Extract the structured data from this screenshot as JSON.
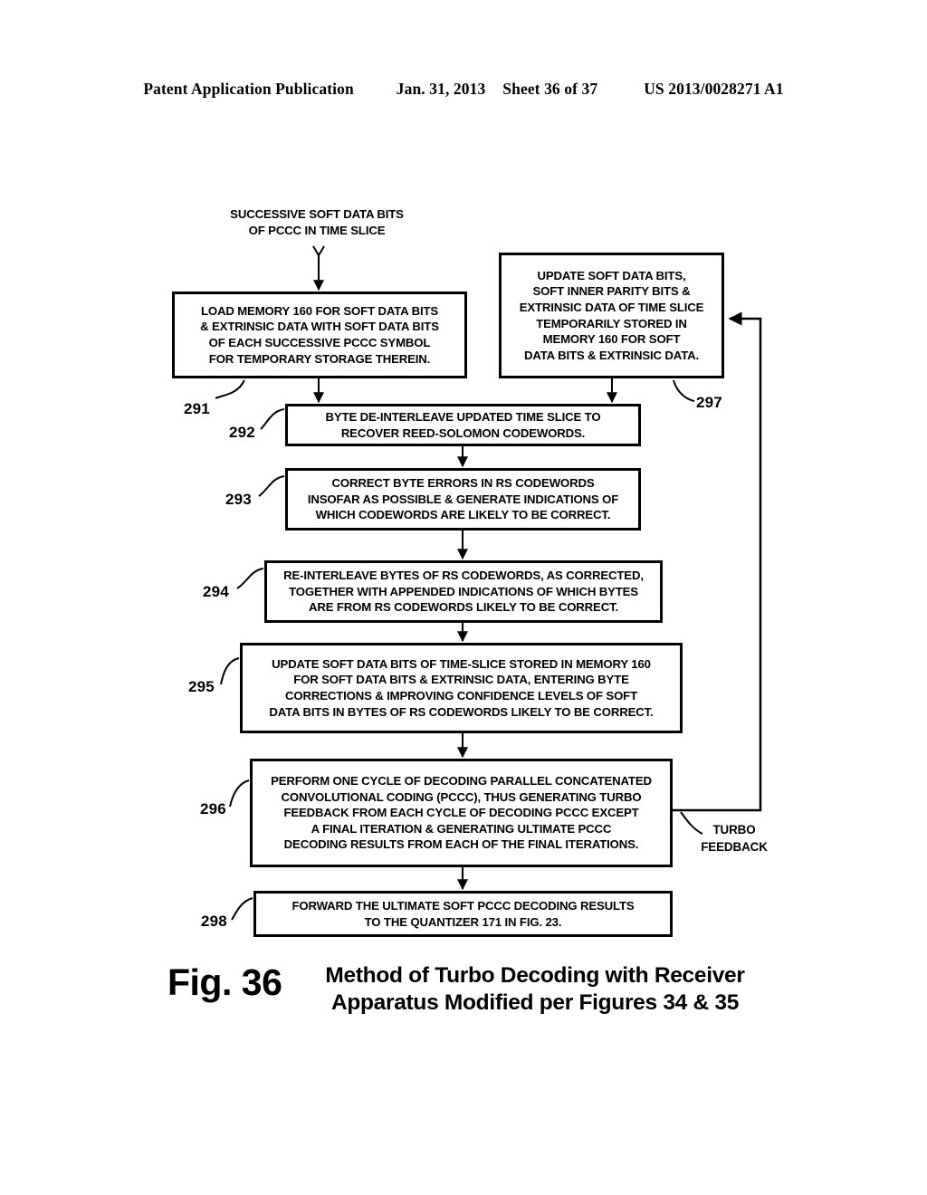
{
  "header": {
    "publication": "Patent Application Publication",
    "date": "Jan. 31, 2013",
    "sheet": "Sheet 36 of 37",
    "pub_number": "US 2013/0028271 A1"
  },
  "figure": {
    "number": "Fig. 36",
    "title": "Method of Turbo Decoding with Receiver\nApparatus Modified per Figures 34 & 35"
  },
  "flowchart": {
    "input_label": "SUCCESSIVE SOFT DATA BITS\nOF PCCC IN TIME SLICE",
    "feedback_label": "TURBO\nFEEDBACK",
    "boxes": [
      {
        "ref": "291",
        "text": "LOAD MEMORY 160 FOR SOFT DATA BITS\n& EXTRINSIC DATA WITH SOFT DATA BITS\nOF EACH SUCCESSIVE PCCC SYMBOL\nFOR TEMPORARY STORAGE THEREIN."
      },
      {
        "ref": "297",
        "text": "UPDATE SOFT DATA BITS,\nSOFT INNER PARITY BITS &\nEXTRINSIC DATA OF TIME SLICE\nTEMPORARILY STORED IN\nMEMORY 160 FOR SOFT\nDATA BITS & EXTRINSIC DATA."
      },
      {
        "ref": "292",
        "text": "BYTE DE-INTERLEAVE UPDATED TIME SLICE TO\nRECOVER REED-SOLOMON CODEWORDS."
      },
      {
        "ref": "293",
        "text": "CORRECT BYTE ERRORS IN RS CODEWORDS\nINSOFAR AS POSSIBLE & GENERATE INDICATIONS OF\nWHICH CODEWORDS ARE LIKELY TO BE CORRECT."
      },
      {
        "ref": "294",
        "text": "RE-INTERLEAVE BYTES OF RS CODEWORDS, AS CORRECTED,\nTOGETHER WITH APPENDED INDICATIONS OF WHICH BYTES\nARE FROM RS CODEWORDS LIKELY TO BE CORRECT."
      },
      {
        "ref": "295",
        "text": "UPDATE SOFT DATA BITS OF TIME-SLICE STORED IN MEMORY 160\nFOR SOFT DATA BITS & EXTRINSIC DATA, ENTERING BYTE\nCORRECTIONS & IMPROVING CONFIDENCE LEVELS OF SOFT\nDATA BITS IN BYTES OF RS CODEWORDS LIKELY TO BE CORRECT."
      },
      {
        "ref": "296",
        "text": "PERFORM ONE CYCLE OF DECODING PARALLEL CONCATENATED\nCONVOLUTIONAL CODING (PCCC), THUS GENERATING TURBO\nFEEDBACK FROM EACH CYCLE OF DECODING PCCC EXCEPT\nA FINAL ITERATION & GENERATING ULTIMATE PCCC\nDECODING RESULTS FROM EACH OF THE FINAL ITERATIONS."
      },
      {
        "ref": "298",
        "text": "FORWARD THE ULTIMATE SOFT PCCC DECODING RESULTS\nTO THE QUANTIZER 171 IN FIG. 23."
      }
    ]
  },
  "colors": {
    "ink": "#000000",
    "paper": "#ffffff"
  }
}
